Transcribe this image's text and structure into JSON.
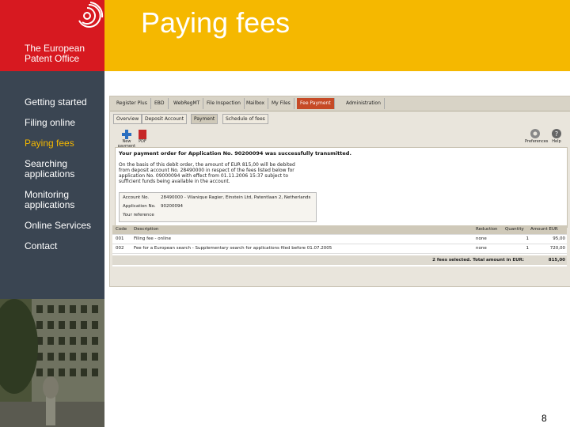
{
  "header": {
    "title": "Paying fees",
    "org_name": "The European\nPatent Office",
    "logo_icon": "epo-logo-icon",
    "colors": {
      "band": "#f5b800",
      "logo_bg": "#d71920",
      "sidebar": "#3a4552",
      "active": "#f5b800"
    }
  },
  "sidebar": {
    "items": [
      {
        "label": "Getting started"
      },
      {
        "label": "Filing online"
      },
      {
        "label": "Paying fees"
      },
      {
        "label": "Searching\napplications"
      },
      {
        "label": "Monitoring\napplications"
      },
      {
        "label": "Online Services"
      },
      {
        "label": "Contact"
      }
    ],
    "active_item": "Paying fees"
  },
  "screenshot": {
    "top_tabs": [
      "Register Plus",
      "EBD",
      "WebRegMT",
      "File Inspection",
      "Mailbox",
      "My Files",
      "Fee Payment",
      "Administration"
    ],
    "selected_top_tab": "Fee Payment",
    "sub_tabs": [
      "Overview",
      "Deposit Account",
      "Payment",
      "Schedule of fees"
    ],
    "selected_sub_tab": "Payment",
    "toolbar": {
      "new_payment": "New payment",
      "pdf": "PDF",
      "preferences": "Preferences",
      "help": "Help"
    },
    "message_title": "Your payment order for Application No. 90200094 was successfully transmitted.",
    "message_body": "On the basis of this debit order, the amount of EUR 815,00 will be debited from deposit account No. 28490000 in respect of the fees listed below for application No. 09000094 with effect from 01.11.2006 15:37 subject to sufficient funds being available in the account.",
    "account": {
      "account_label": "Account No.",
      "account_value": "28490000 - Vilanique Ragier, Einstein Ltd, Patentlaan 2, Netherlands",
      "application_label": "Application No.",
      "application_value": "90200094",
      "reference_label": "Your reference",
      "reference_value": ""
    },
    "fees_table": {
      "columns": [
        "Code",
        "Description",
        "Reduction",
        "Quantity",
        "Amount EUR"
      ],
      "rows": [
        [
          "001",
          "Filing fee - online",
          "none",
          "1",
          "95,00"
        ],
        [
          "002",
          "Fee for a European search - Supplementary search for applications filed before 01.07.2005",
          "none",
          "1",
          "720,00"
        ]
      ],
      "summary_text": "2 fees selected. Total amount in EUR:",
      "summary_total": "815,00"
    }
  },
  "slide_number": "8"
}
